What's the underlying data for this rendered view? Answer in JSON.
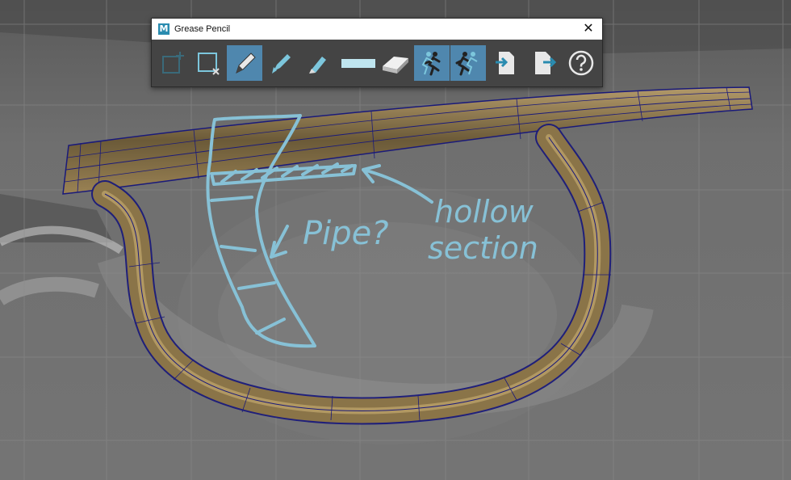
{
  "window": {
    "title": "Grease Pencil",
    "app_icon_letter": "M",
    "close_glyph": "✕"
  },
  "toolbar": {
    "tools": [
      {
        "name": "add-frame-icon",
        "active": false
      },
      {
        "name": "delete-frame-icon",
        "active": false
      },
      {
        "name": "pencil-icon",
        "active": true
      },
      {
        "name": "marker-icon",
        "active": false
      },
      {
        "name": "soft-pencil-icon",
        "active": false
      },
      {
        "name": "brush-size-icon",
        "active": false
      },
      {
        "name": "eraser-icon",
        "active": false
      },
      {
        "name": "ghost-previous-icon",
        "active": true
      },
      {
        "name": "ghost-next-icon",
        "active": true
      },
      {
        "name": "import-icon",
        "active": false
      },
      {
        "name": "export-icon",
        "active": false
      },
      {
        "name": "help-icon",
        "active": false
      }
    ]
  },
  "annotations": {
    "pipe_label": "Pipe?",
    "hollow_line1": "hollow",
    "hollow_line2": "section"
  },
  "colors": {
    "sketch": "#87c1d6",
    "wire": "#1a1a7a",
    "trigger_guard": "#8a7448",
    "active_tool": "#4f87ae"
  }
}
